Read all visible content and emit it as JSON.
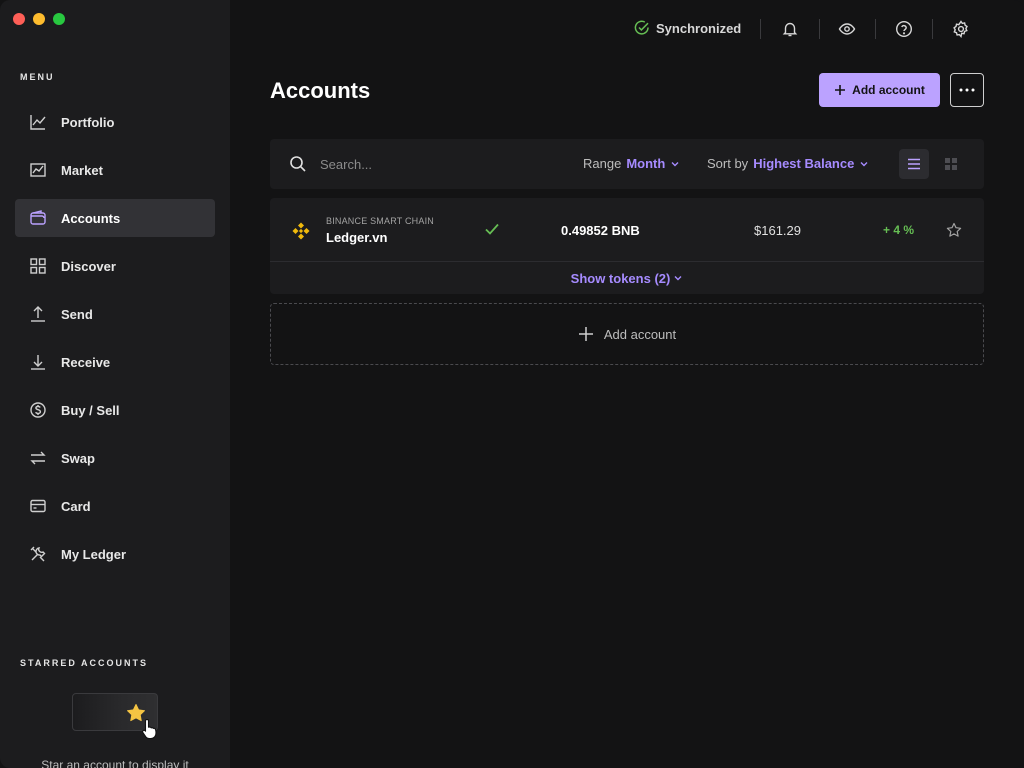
{
  "sidebar": {
    "menu_label": "MENU",
    "items": [
      {
        "label": "Portfolio",
        "icon": "chart-line-icon",
        "active": false
      },
      {
        "label": "Market",
        "icon": "market-icon",
        "active": false
      },
      {
        "label": "Accounts",
        "icon": "wallet-icon",
        "active": true
      },
      {
        "label": "Discover",
        "icon": "grid-icon",
        "active": false
      },
      {
        "label": "Send",
        "icon": "arrow-up-icon",
        "active": false
      },
      {
        "label": "Receive",
        "icon": "arrow-down-icon",
        "active": false
      },
      {
        "label": "Buy / Sell",
        "icon": "dollar-icon",
        "active": false
      },
      {
        "label": "Swap",
        "icon": "swap-icon",
        "active": false
      },
      {
        "label": "Card",
        "icon": "card-icon",
        "active": false
      },
      {
        "label": "My Ledger",
        "icon": "tools-icon",
        "active": false
      }
    ],
    "starred_label": "STARRED ACCOUNTS",
    "starred_hint": "Star an account to display it"
  },
  "topbar": {
    "sync_status": "Synchronized",
    "icons": [
      "bell-icon",
      "eye-icon",
      "help-icon",
      "settings-icon"
    ]
  },
  "main": {
    "title": "Accounts",
    "add_account_label": "Add account",
    "search_placeholder": "Search...",
    "range_label": "Range",
    "range_value": "Month",
    "sort_label": "Sort by",
    "sort_value": "Highest Balance",
    "accounts": [
      {
        "chain": "BINANCE SMART CHAIN",
        "name": "Ledger.vn",
        "balance": "0.49852 BNB",
        "fiat": "$161.29",
        "change": "+ 4 %"
      }
    ],
    "show_tokens_label": "Show tokens (2)",
    "add_account_box_label": "Add account"
  },
  "colors": {
    "accent": "#bba2ff",
    "accent_text": "#a68bff",
    "positive": "#66be54",
    "bnb": "#f0b90b",
    "sync": "#66be54"
  }
}
